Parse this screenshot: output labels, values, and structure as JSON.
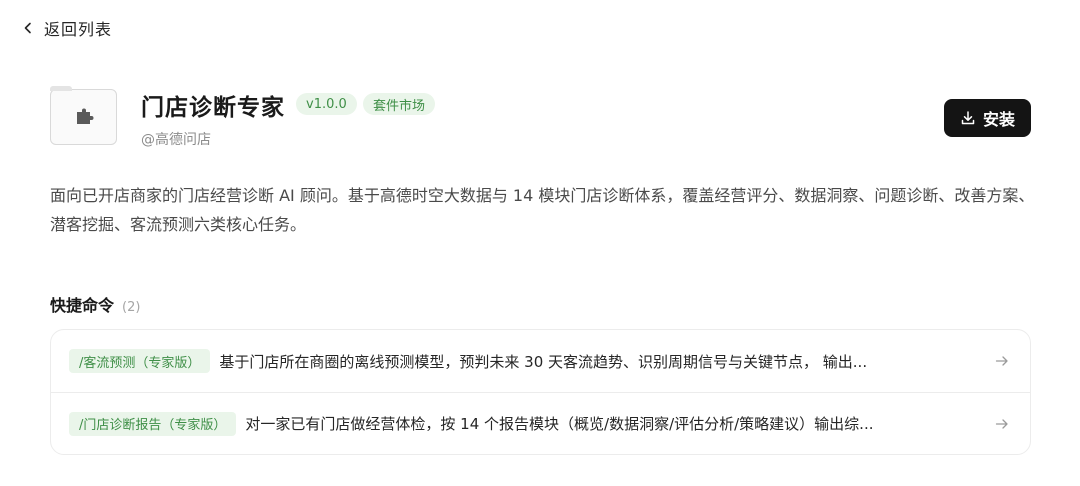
{
  "nav": {
    "back_label": "返回列表",
    "back_icon": "chevron-left-icon"
  },
  "plugin": {
    "icon": "puzzle-piece-icon",
    "title": "门店诊断专家",
    "version": "v1.0.0",
    "category": "套件市场",
    "author": "@高德问店",
    "description": "面向已开店商家的门店经营诊断 AI 顾问。基于高德时空大数据与 14 模块门店诊断体系，覆盖经营评分、数据洞察、问题诊断、改善方案、潜客挖掘、客流预测六类核心任务。"
  },
  "actions": {
    "install_label": "安装",
    "install_icon": "download-icon"
  },
  "commands": {
    "title": "快捷命令",
    "count": "(2)",
    "items": [
      {
        "tag": "/客流预测（专家版）",
        "text": "基于门店所在商圈的离线预测模型，预判未来 30 天客流趋势、识别周期信号与关键节点， 输出...",
        "icon": "arrow-right-icon"
      },
      {
        "tag": "/门店诊断报告（专家版）",
        "text": "对一家已有门店做经营体检，按 14 个报告模块（概览/数据洞察/评估分析/策略建议）输出综...",
        "icon": "arrow-right-icon"
      }
    ]
  },
  "colors": {
    "accent_green": "#3f8f47",
    "tag_bg": "#eaf5ea",
    "button_bg": "#141414"
  }
}
